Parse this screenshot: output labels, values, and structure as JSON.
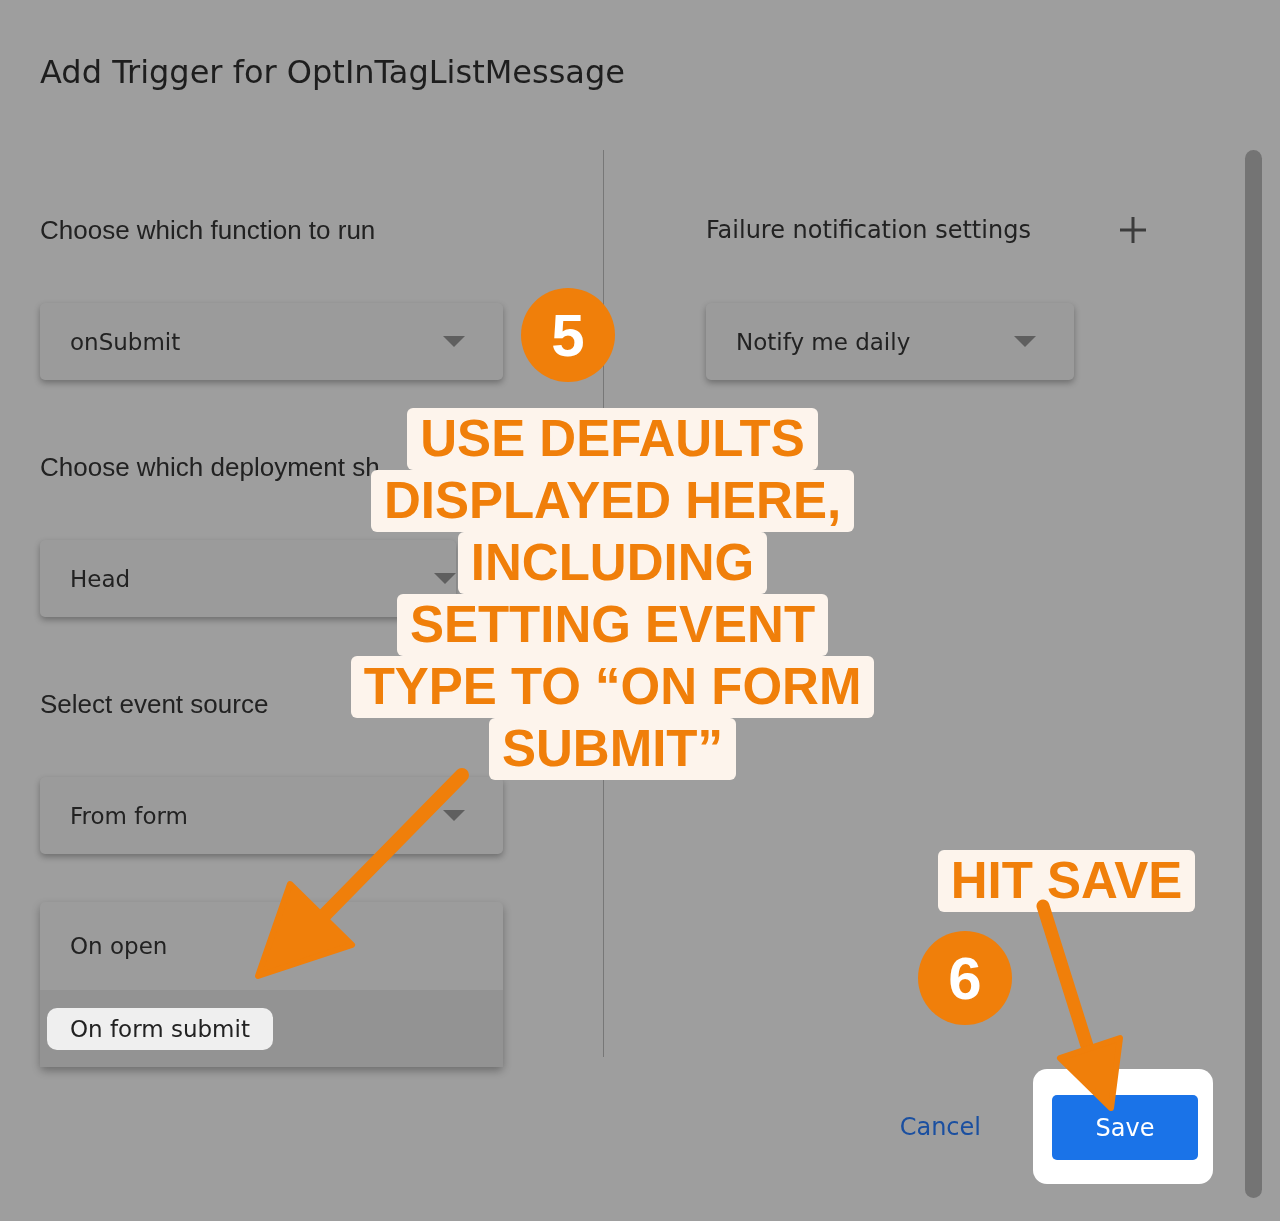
{
  "dialog": {
    "title": "Add Trigger for OptInTagListMessage"
  },
  "left_fields": [
    {
      "label": "Choose which function to run",
      "value": "onSubmit"
    },
    {
      "label": "Choose which deployment sh",
      "value": "Head"
    },
    {
      "label": "Select event source",
      "value": "From form"
    }
  ],
  "event_type_menu": [
    {
      "label": "On open",
      "selected": false
    },
    {
      "label": "On form submit",
      "selected": true
    }
  ],
  "failure_notifications": {
    "label": "Failure notification settings",
    "value": "Notify me daily"
  },
  "buttons": {
    "cancel": "Cancel",
    "save": "Save"
  },
  "annotations": {
    "badges": [
      "5",
      "6"
    ],
    "callouts": [
      {
        "lines": [
          "USE DEFAULTS",
          "DISPLAYED HERE,",
          "INCLUDING",
          "SETTING EVENT",
          "TYPE TO “ON FORM",
          "SUBMIT”"
        ]
      },
      {
        "lines": [
          "HIT SAVE"
        ]
      }
    ]
  }
}
